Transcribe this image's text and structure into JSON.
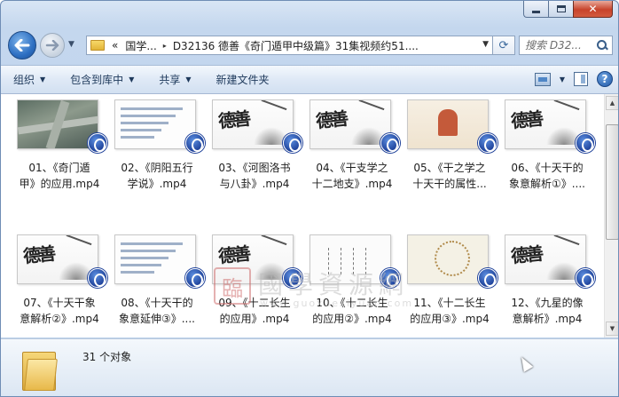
{
  "window": {
    "minimize_icon": "minimize-icon",
    "maximize_icon": "maximize-icon",
    "close_glyph": "✕"
  },
  "address_bar": {
    "overflow": "«",
    "crumbs": [
      "国学...",
      "D32136 德善《奇门遁甲中级篇》31集视频约51...."
    ],
    "separator": "▸"
  },
  "search": {
    "placeholder": "搜索 D32..."
  },
  "toolbar": {
    "organize": "组织",
    "include_library": "包含到库中",
    "share": "共享",
    "new_folder": "新建文件夹"
  },
  "files": [
    {
      "label": "01、《奇门遁\n甲》的应用.mp4",
      "thumb": "street"
    },
    {
      "label": "02、《阴阳五行\n学说》.mp4",
      "thumb": "doc"
    },
    {
      "label": "03、《河图洛书\n与八卦》.mp4",
      "thumb": "ink"
    },
    {
      "label": "04、《干支学之\n十二地支》.mp4",
      "thumb": "ink"
    },
    {
      "label": "05、《干之学之\n十天干的属性...",
      "thumb": "color"
    },
    {
      "label": "06、《十天干的\n象意解析①》....",
      "thumb": "ink"
    },
    {
      "label": "07、《十天干象\n意解析②》.mp4",
      "thumb": "ink"
    },
    {
      "label": "08、《十天干的\n象意延伸③》....",
      "thumb": "doc"
    },
    {
      "label": "09、《十二长生\n的应用》.mp4",
      "thumb": "ink"
    },
    {
      "label": "10、《十二长生\n的应用②》.mp4",
      "thumb": "table"
    },
    {
      "label": "11、《十二长生\n的应用③》.mp4",
      "thumb": "wheel"
    },
    {
      "label": "12、《九星的像\n意解析》.mp4",
      "thumb": "ink"
    }
  ],
  "watermark": {
    "seal": "臨",
    "title": "國學資源網",
    "url": "www.guoxueziyuan.com"
  },
  "thumb_brush_text": "德善",
  "status": {
    "count": "31 个对象"
  }
}
